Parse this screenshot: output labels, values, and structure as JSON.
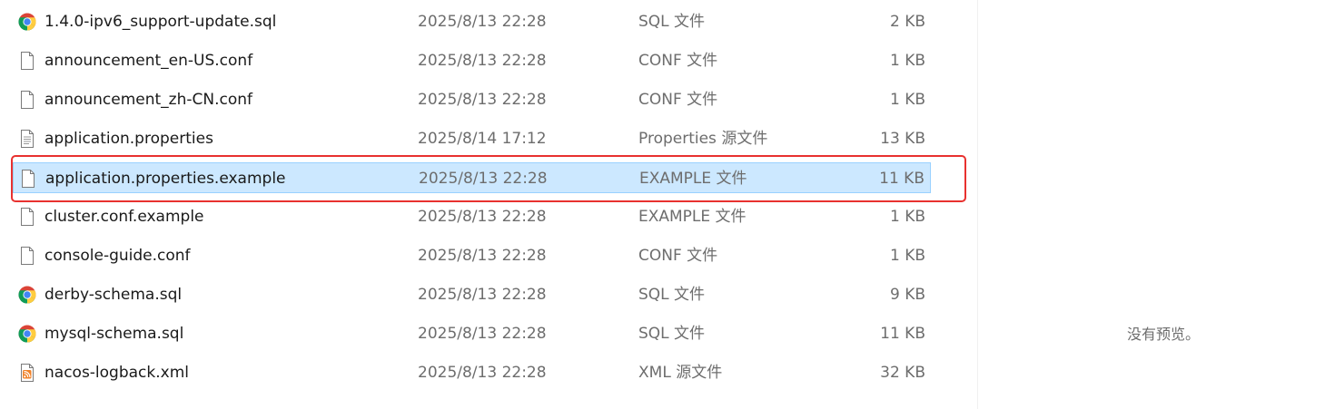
{
  "files": [
    {
      "name": "1.4.0-ipv6_support-update.sql",
      "date": "2025/8/13 22:28",
      "type": "SQL 文件",
      "size": "2 KB",
      "icon": "chrome-icon",
      "selected": false
    },
    {
      "name": "announcement_en-US.conf",
      "date": "2025/8/13 22:28",
      "type": "CONF 文件",
      "size": "1 KB",
      "icon": "file-icon",
      "selected": false
    },
    {
      "name": "announcement_zh-CN.conf",
      "date": "2025/8/13 22:28",
      "type": "CONF 文件",
      "size": "1 KB",
      "icon": "file-icon",
      "selected": false
    },
    {
      "name": "application.properties",
      "date": "2025/8/14 17:12",
      "type": "Properties 源文件",
      "size": "13 KB",
      "icon": "text-file-icon",
      "selected": false
    },
    {
      "name": "application.properties.example",
      "date": "2025/8/13 22:28",
      "type": "EXAMPLE 文件",
      "size": "11 KB",
      "icon": "file-icon",
      "selected": true
    },
    {
      "name": "cluster.conf.example",
      "date": "2025/8/13 22:28",
      "type": "EXAMPLE 文件",
      "size": "1 KB",
      "icon": "file-icon",
      "selected": false
    },
    {
      "name": "console-guide.conf",
      "date": "2025/8/13 22:28",
      "type": "CONF 文件",
      "size": "1 KB",
      "icon": "file-icon",
      "selected": false
    },
    {
      "name": "derby-schema.sql",
      "date": "2025/8/13 22:28",
      "type": "SQL 文件",
      "size": "9 KB",
      "icon": "chrome-icon",
      "selected": false
    },
    {
      "name": "mysql-schema.sql",
      "date": "2025/8/13 22:28",
      "type": "SQL 文件",
      "size": "11 KB",
      "icon": "chrome-icon",
      "selected": false
    },
    {
      "name": "nacos-logback.xml",
      "date": "2025/8/13 22:28",
      "type": "XML 源文件",
      "size": "32 KB",
      "icon": "xml-feed-icon",
      "selected": false
    }
  ],
  "preview": {
    "empty_text": "没有预览。"
  },
  "colors": {
    "selection_bg": "#cce8ff",
    "selection_border": "#99d1ff",
    "highlight_box": "#e8312f",
    "secondary_text": "#6d6d6d"
  }
}
